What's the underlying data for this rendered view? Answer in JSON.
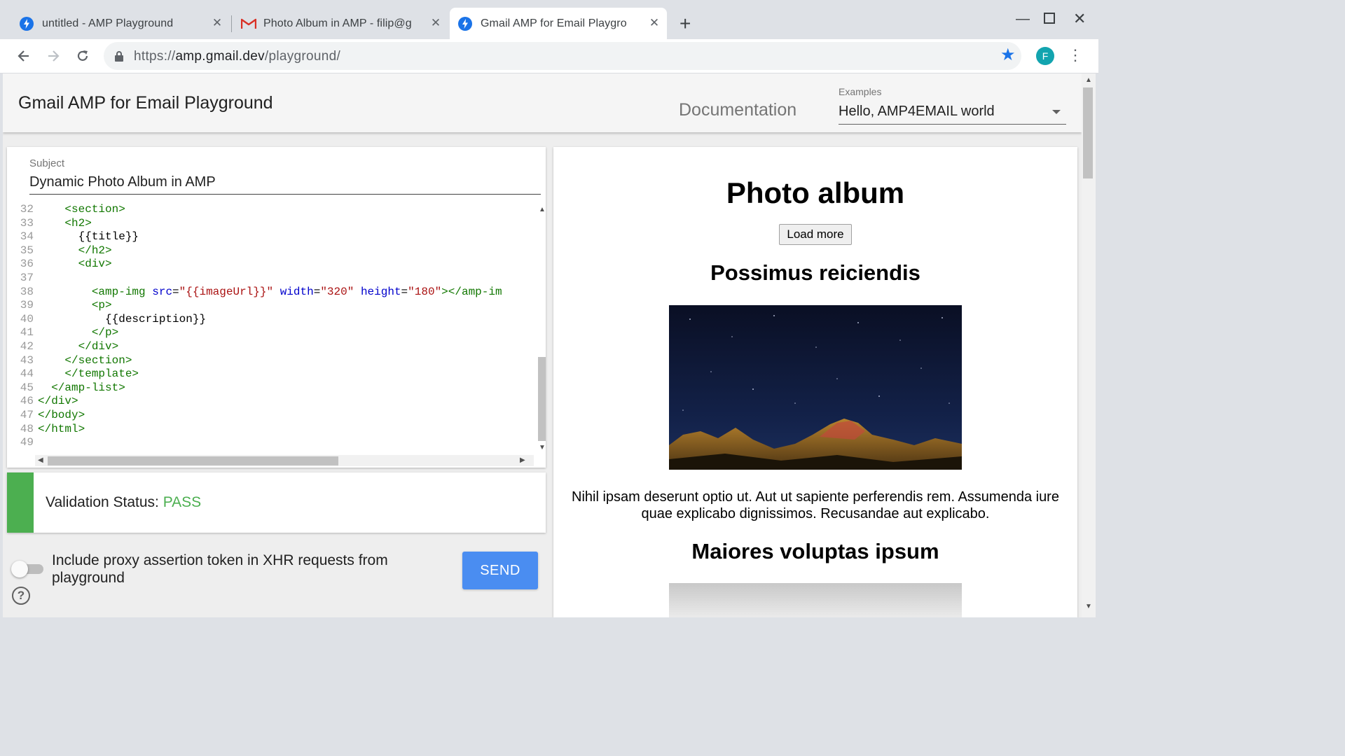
{
  "browser": {
    "tabs": [
      {
        "title": "untitled - AMP Playground",
        "icon": "amp-bolt-icon"
      },
      {
        "title": "Photo Album in AMP - filip@g",
        "icon": "gmail-icon"
      },
      {
        "title": "Gmail AMP for Email Playgro",
        "icon": "amp-bolt-icon",
        "active": true
      }
    ],
    "new_tab": "+",
    "url": {
      "scheme": "https://",
      "host": "amp.gmail.dev",
      "path": "/playground/"
    },
    "profile_initial": "F"
  },
  "app": {
    "title": "Gmail AMP for Email Playground",
    "documentation_link": "Documentation",
    "examples_label": "Examples",
    "examples_selected": "Hello, AMP4EMAIL world"
  },
  "editor": {
    "subject_label": "Subject",
    "subject_value": "Dynamic Photo Album in AMP",
    "lines": [
      {
        "n": "32",
        "indent": "    ",
        "tokens": [
          {
            "t": "tg",
            "v": "<section>"
          }
        ]
      },
      {
        "n": "33",
        "indent": "    ",
        "tokens": [
          {
            "t": "tg",
            "v": "<h2>"
          }
        ]
      },
      {
        "n": "34",
        "indent": "      ",
        "tokens": [
          {
            "t": "tx",
            "v": "{{title}}"
          }
        ]
      },
      {
        "n": "35",
        "indent": "      ",
        "tokens": [
          {
            "t": "tg",
            "v": "</h2>"
          }
        ]
      },
      {
        "n": "36",
        "indent": "      ",
        "tokens": [
          {
            "t": "tg",
            "v": "<div>"
          }
        ]
      },
      {
        "n": "37",
        "indent": "",
        "tokens": []
      },
      {
        "n": "38",
        "indent": "        ",
        "tokens": [
          {
            "t": "tg",
            "v": "<amp-img "
          },
          {
            "t": "at",
            "v": "src"
          },
          {
            "t": "tx",
            "v": "="
          },
          {
            "t": "st",
            "v": "\"{{imageUrl}}\""
          },
          {
            "t": "tx",
            "v": " "
          },
          {
            "t": "at",
            "v": "width"
          },
          {
            "t": "tx",
            "v": "="
          },
          {
            "t": "st",
            "v": "\"320\""
          },
          {
            "t": "tx",
            "v": " "
          },
          {
            "t": "at",
            "v": "height"
          },
          {
            "t": "tx",
            "v": "="
          },
          {
            "t": "st",
            "v": "\"180\""
          },
          {
            "t": "tg",
            "v": "></amp-im"
          }
        ]
      },
      {
        "n": "39",
        "indent": "        ",
        "tokens": [
          {
            "t": "tg",
            "v": "<p>"
          }
        ]
      },
      {
        "n": "40",
        "indent": "          ",
        "tokens": [
          {
            "t": "tx",
            "v": "{{description}}"
          }
        ]
      },
      {
        "n": "41",
        "indent": "        ",
        "tokens": [
          {
            "t": "tg",
            "v": "</p>"
          }
        ]
      },
      {
        "n": "42",
        "indent": "      ",
        "tokens": [
          {
            "t": "tg",
            "v": "</div>"
          }
        ]
      },
      {
        "n": "43",
        "indent": "    ",
        "tokens": [
          {
            "t": "tg",
            "v": "</section>"
          }
        ]
      },
      {
        "n": "44",
        "indent": "    ",
        "tokens": [
          {
            "t": "tg",
            "v": "</template>"
          }
        ]
      },
      {
        "n": "45",
        "indent": "  ",
        "tokens": [
          {
            "t": "tg",
            "v": "</amp-list>"
          }
        ]
      },
      {
        "n": "46",
        "indent": "",
        "tokens": [
          {
            "t": "tg",
            "v": "</div>"
          }
        ]
      },
      {
        "n": "47",
        "indent": "",
        "tokens": [
          {
            "t": "tg",
            "v": "</body>"
          }
        ]
      },
      {
        "n": "48",
        "indent": "",
        "tokens": [
          {
            "t": "tg",
            "v": "</html>"
          }
        ]
      },
      {
        "n": "49",
        "indent": "",
        "tokens": []
      }
    ]
  },
  "validation": {
    "label": "Validation Status: ",
    "status": "PASS"
  },
  "proxy_toggle": {
    "label": "Include proxy assertion token in XHR requests from playground",
    "checked": false
  },
  "send_button": "SEND",
  "help_icon": "?",
  "preview": {
    "heading": "Photo album",
    "load_more": "Load more",
    "items": [
      {
        "title": "Possimus reiciendis",
        "description": "Nihil ipsam deserunt optio ut. Aut ut sapiente perferendis rem. Assumenda iure quae explicabo dignissimos. Recusandae aut explicabo."
      },
      {
        "title": "Maiores voluptas ipsum"
      }
    ]
  },
  "colors": {
    "accent": "#4a8df1",
    "pass": "#4caf50",
    "chrome_blue": "#1a73e8"
  }
}
